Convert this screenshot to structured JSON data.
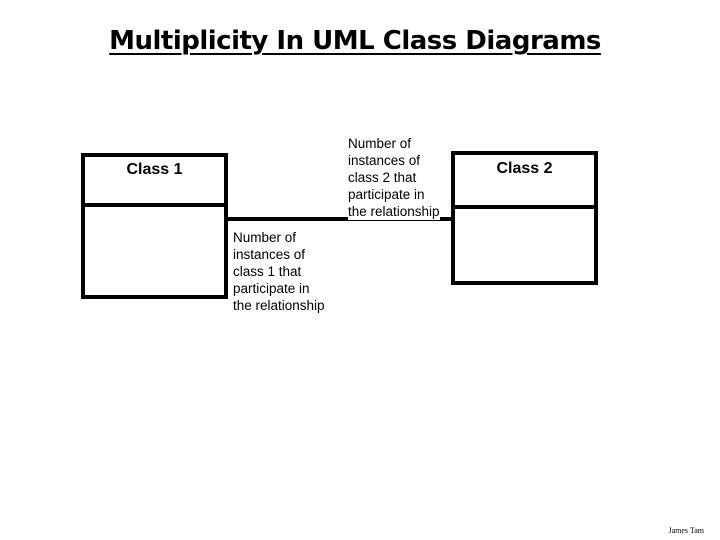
{
  "title": "Multiplicity In UML Class Diagrams",
  "classes": [
    {
      "name": "Class 1"
    },
    {
      "name": "Class 2"
    }
  ],
  "annotations": {
    "class2_side": "Number of\ninstances of\nclass 2 that\nparticipate in\nthe relationship",
    "class1_side": "Number of\ninstances of\nclass 1 that\nparticipate in\nthe relationship"
  },
  "footer": "James Tam"
}
